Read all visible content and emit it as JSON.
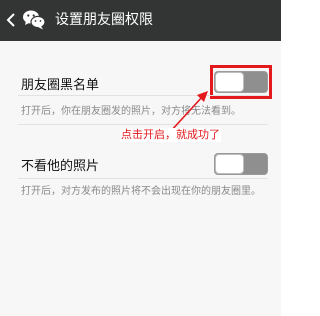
{
  "header": {
    "title": "设置朋友圈权限"
  },
  "settings": [
    {
      "label": "朋友圈黑名单",
      "description": "打开后，你在朋友圈发的照片，对方将无法看到。",
      "toggle_on": false
    },
    {
      "label": "不看他的照片",
      "description": "打开后，对方发布的照片将不会出现在你的朋友圈里。",
      "toggle_on": false
    }
  ],
  "annotation": {
    "text": "点击开启，就成功了"
  },
  "colors": {
    "header_bg": "#333534",
    "annotation_red": "#e3191d",
    "toggle_track": "#8f8f8f"
  }
}
